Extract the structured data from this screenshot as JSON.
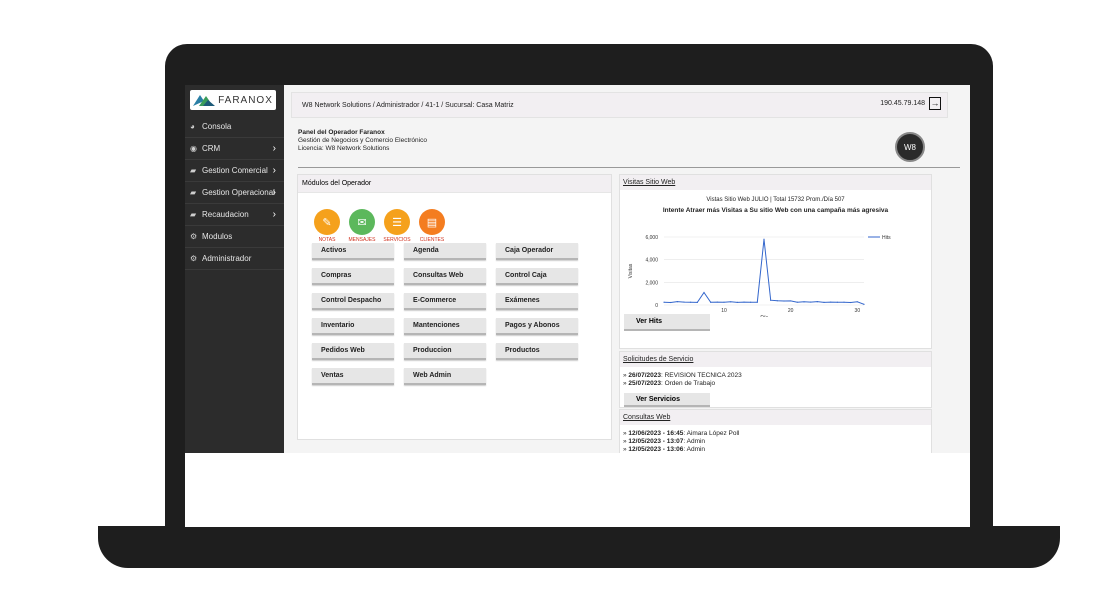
{
  "logo": {
    "text": "FARANOX"
  },
  "sidebar": {
    "items": [
      {
        "label": "Consola",
        "icon": "dashboard-icon",
        "chevron": false
      },
      {
        "label": "CRM",
        "icon": "eye-icon",
        "chevron": true
      },
      {
        "label": "Gestion Comercial",
        "icon": "book-icon",
        "chevron": true
      },
      {
        "label": "Gestion Operacional",
        "icon": "book-icon",
        "chevron": true
      },
      {
        "label": "Recaudacion",
        "icon": "book-icon",
        "chevron": true
      },
      {
        "label": "Modulos",
        "icon": "cogs-icon",
        "chevron": false
      },
      {
        "label": "Administrador",
        "icon": "cogs-icon",
        "chevron": false
      }
    ]
  },
  "topbar": {
    "breadcrumb": "W8 Network Solutions / Administrador / 41-1 / Sucursal: Casa Matriz",
    "ip": "190.45.79.148"
  },
  "panel": {
    "title": "Panel del Operador Faranox",
    "subtitle": "Gestión de Negocios y Comercio Electrónico",
    "license": "Licencia: W8 Network Solutions"
  },
  "brand_logo": {
    "text": "W8"
  },
  "modules": {
    "title": "Módulos del Operador",
    "quick": [
      {
        "label": "NOTAS",
        "color": "#f5a11c",
        "glyph": "✎"
      },
      {
        "label": "MENSAJES",
        "color": "#5cb85c",
        "glyph": "✉"
      },
      {
        "label": "SERVICIOS",
        "color": "#f5a11c",
        "glyph": "☰"
      },
      {
        "label": "CLIENTES",
        "color": "#f47d20",
        "glyph": "▤"
      }
    ],
    "buttons": [
      [
        "Activos",
        "Agenda",
        "Caja Operador"
      ],
      [
        "Compras",
        "Consultas Web",
        "Control Caja"
      ],
      [
        "Control Despacho",
        "E-Commerce",
        "Exámenes"
      ],
      [
        "Inventario",
        "Mantenciones",
        "Pagos y Abonos"
      ],
      [
        "Pedidos Web",
        "Produccion",
        "Productos"
      ],
      [
        "Ventas",
        "Web Admin",
        ""
      ]
    ]
  },
  "visits": {
    "title": "Visitas Sitio Web",
    "line1": "Vistas Sitio Web JULIO | Total 15732 Prom./Día 507",
    "line2": "Intente Atraer más Visitas a Su sitio Web con una campaña más agresiva",
    "button": "Ver Hits"
  },
  "chart_data": {
    "type": "line",
    "xlabel": "Día",
    "ylabel": "Visitas",
    "ylim": [
      0,
      6000
    ],
    "yticks": [
      "6,000",
      "4,000",
      "2,000",
      "0"
    ],
    "xticks": [
      "10",
      "20",
      "30"
    ],
    "series": [
      {
        "name": "Hits",
        "color": "#3366cc",
        "x": [
          1,
          2,
          3,
          4,
          5,
          6,
          7,
          8,
          9,
          10,
          11,
          12,
          13,
          14,
          15,
          16,
          17,
          18,
          19,
          20,
          21,
          22,
          23,
          24,
          25,
          26,
          27,
          28,
          29,
          30,
          31
        ],
        "values": [
          250,
          220,
          300,
          260,
          240,
          230,
          1100,
          240,
          260,
          250,
          280,
          230,
          260,
          240,
          250,
          5800,
          420,
          380,
          350,
          360,
          250,
          280,
          260,
          300,
          230,
          260,
          240,
          250,
          220,
          280,
          60
        ]
      }
    ]
  },
  "services": {
    "title": "Solicitudes de Servicio",
    "items": [
      {
        "date": "26/07/2023",
        "text": ": REVISION TECNICA 2023"
      },
      {
        "date": "25/07/2023",
        "text": ": Orden de Trabajo"
      }
    ],
    "button": "Ver Servicios"
  },
  "web": {
    "title": "Consultas Web",
    "items": [
      {
        "date": "12/06/2023 - 16:45",
        "text": ": Aimara López Poll"
      },
      {
        "date": "12/05/2023 - 13:07",
        "text": ": Admin"
      },
      {
        "date": "12/05/2023 - 13:06",
        "text": ": Admin"
      }
    ]
  }
}
